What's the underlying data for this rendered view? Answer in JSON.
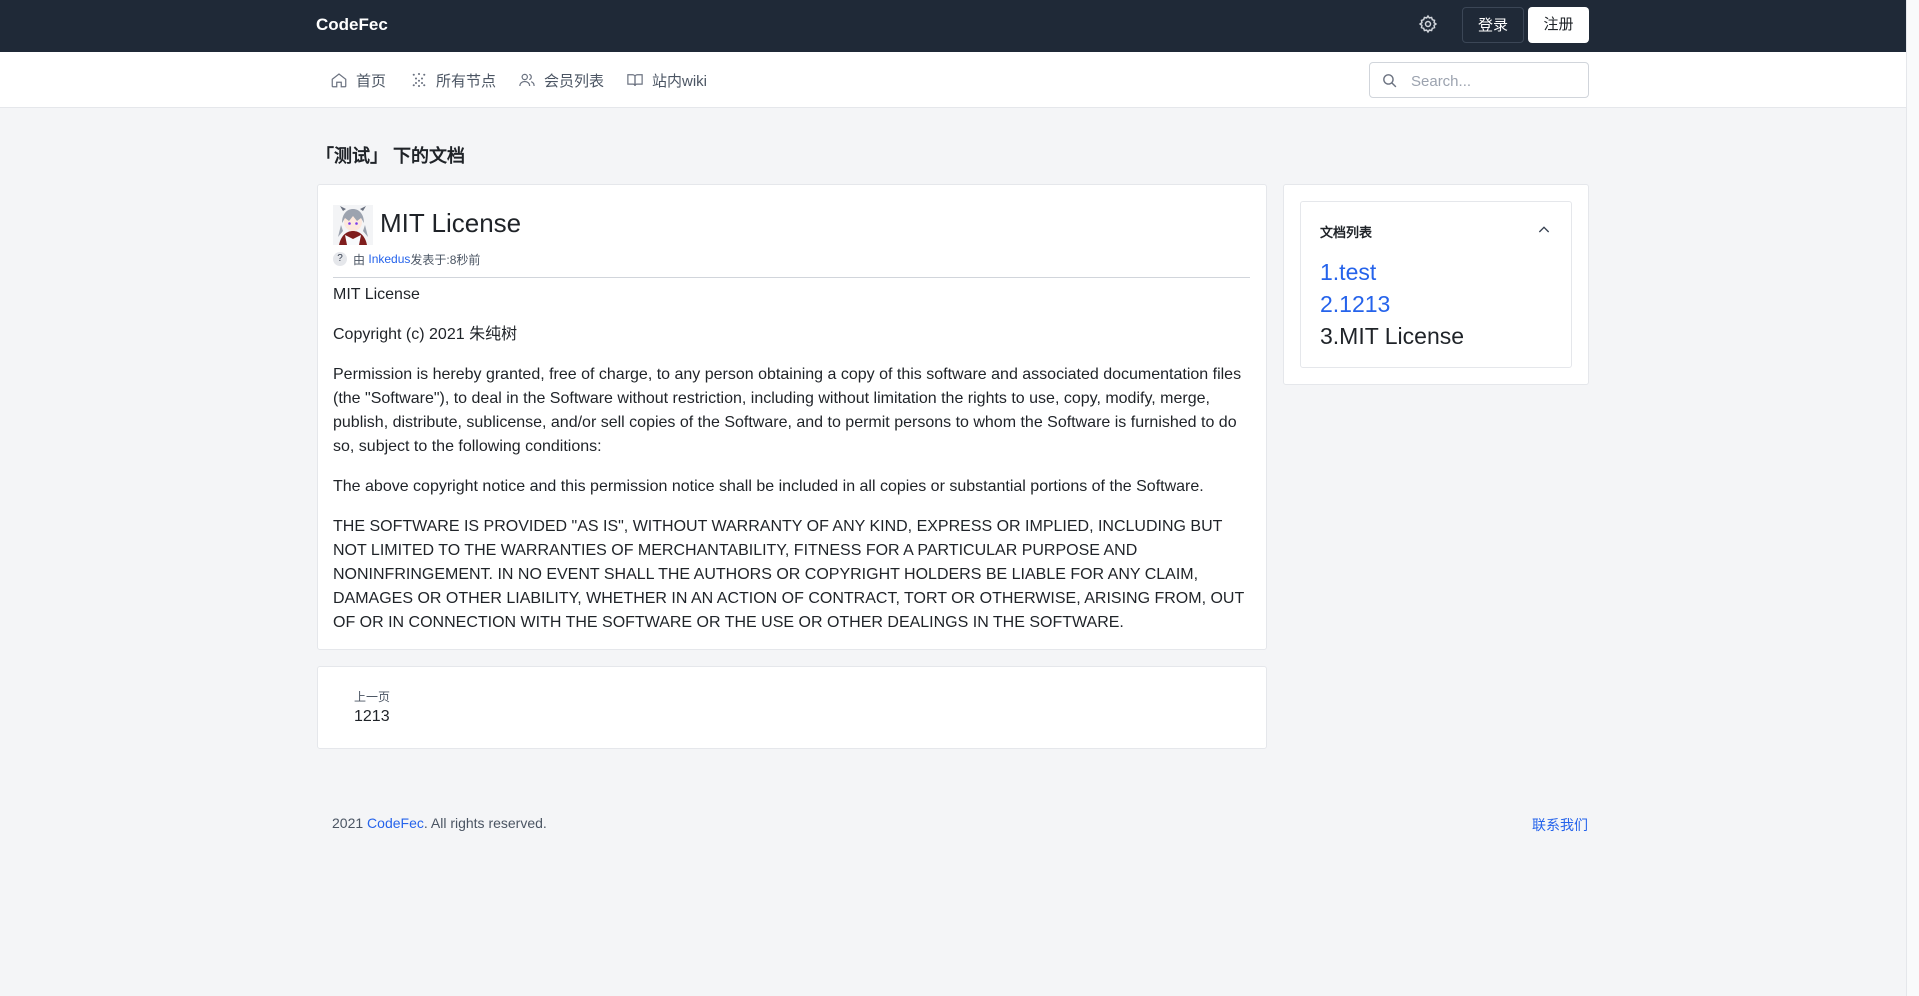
{
  "header": {
    "brand": "CodeFec",
    "settings_icon": "gear-icon",
    "login_label": "登录",
    "register_label": "注册"
  },
  "nav": {
    "items": [
      {
        "label": "首页",
        "icon": "home-icon"
      },
      {
        "label": "所有节点",
        "icon": "nodes-icon"
      },
      {
        "label": "会员列表",
        "icon": "users-icon"
      },
      {
        "label": "站内wiki",
        "icon": "book-icon"
      }
    ],
    "search_placeholder": "Search...",
    "search_value": ""
  },
  "page": {
    "heading": "「测试」 下的文档"
  },
  "doc": {
    "title": "MIT License",
    "meta_icon": "?",
    "meta_prefix": "由",
    "author": "Inkedus",
    "meta_suffix": "发表于:8秒前",
    "paragraphs": [
      "MIT License",
      "Copyright (c) 2021 朱纯树",
      "Permission is hereby granted, free of charge, to any person obtaining a copy of this software and associated documentation files (the \"Software\"), to deal in the Software without restriction, including without limitation the rights to use, copy, modify, merge, publish, distribute, sublicense, and/or sell copies of the Software, and to permit persons to whom the Software is furnished to do so, subject to the following conditions:",
      "The above copyright notice and this permission notice shall be included in all copies or substantial portions of the Software.",
      "THE SOFTWARE IS PROVIDED \"AS IS\", WITHOUT WARRANTY OF ANY KIND, EXPRESS OR IMPLIED, INCLUDING BUT NOT LIMITED TO THE WARRANTIES OF MERCHANTABILITY, FITNESS FOR A PARTICULAR PURPOSE AND NONINFRINGEMENT. IN NO EVENT SHALL THE AUTHORS OR COPYRIGHT HOLDERS BE LIABLE FOR ANY CLAIM, DAMAGES OR OTHER LIABILITY, WHETHER IN AN ACTION OF CONTRACT, TORT OR OTHERWISE, ARISING FROM, OUT OF OR IN CONNECTION WITH THE SOFTWARE OR THE USE OR OTHER DEALINGS IN THE SOFTWARE."
    ]
  },
  "pagination": {
    "prev_label": "上一页",
    "prev_title": "1213"
  },
  "sidebar": {
    "title": "文档列表",
    "items": [
      {
        "label": "1.test"
      },
      {
        "label": "2.1213"
      },
      {
        "label": "3.MIT License"
      }
    ]
  },
  "footer": {
    "year": "2021 ",
    "brand": "CodeFec",
    "rights": ". All rights reserved.",
    "contact": "联系我们"
  },
  "colors": {
    "topbar": "#1f2937",
    "link": "#2563eb",
    "background": "#f4f5f7"
  }
}
